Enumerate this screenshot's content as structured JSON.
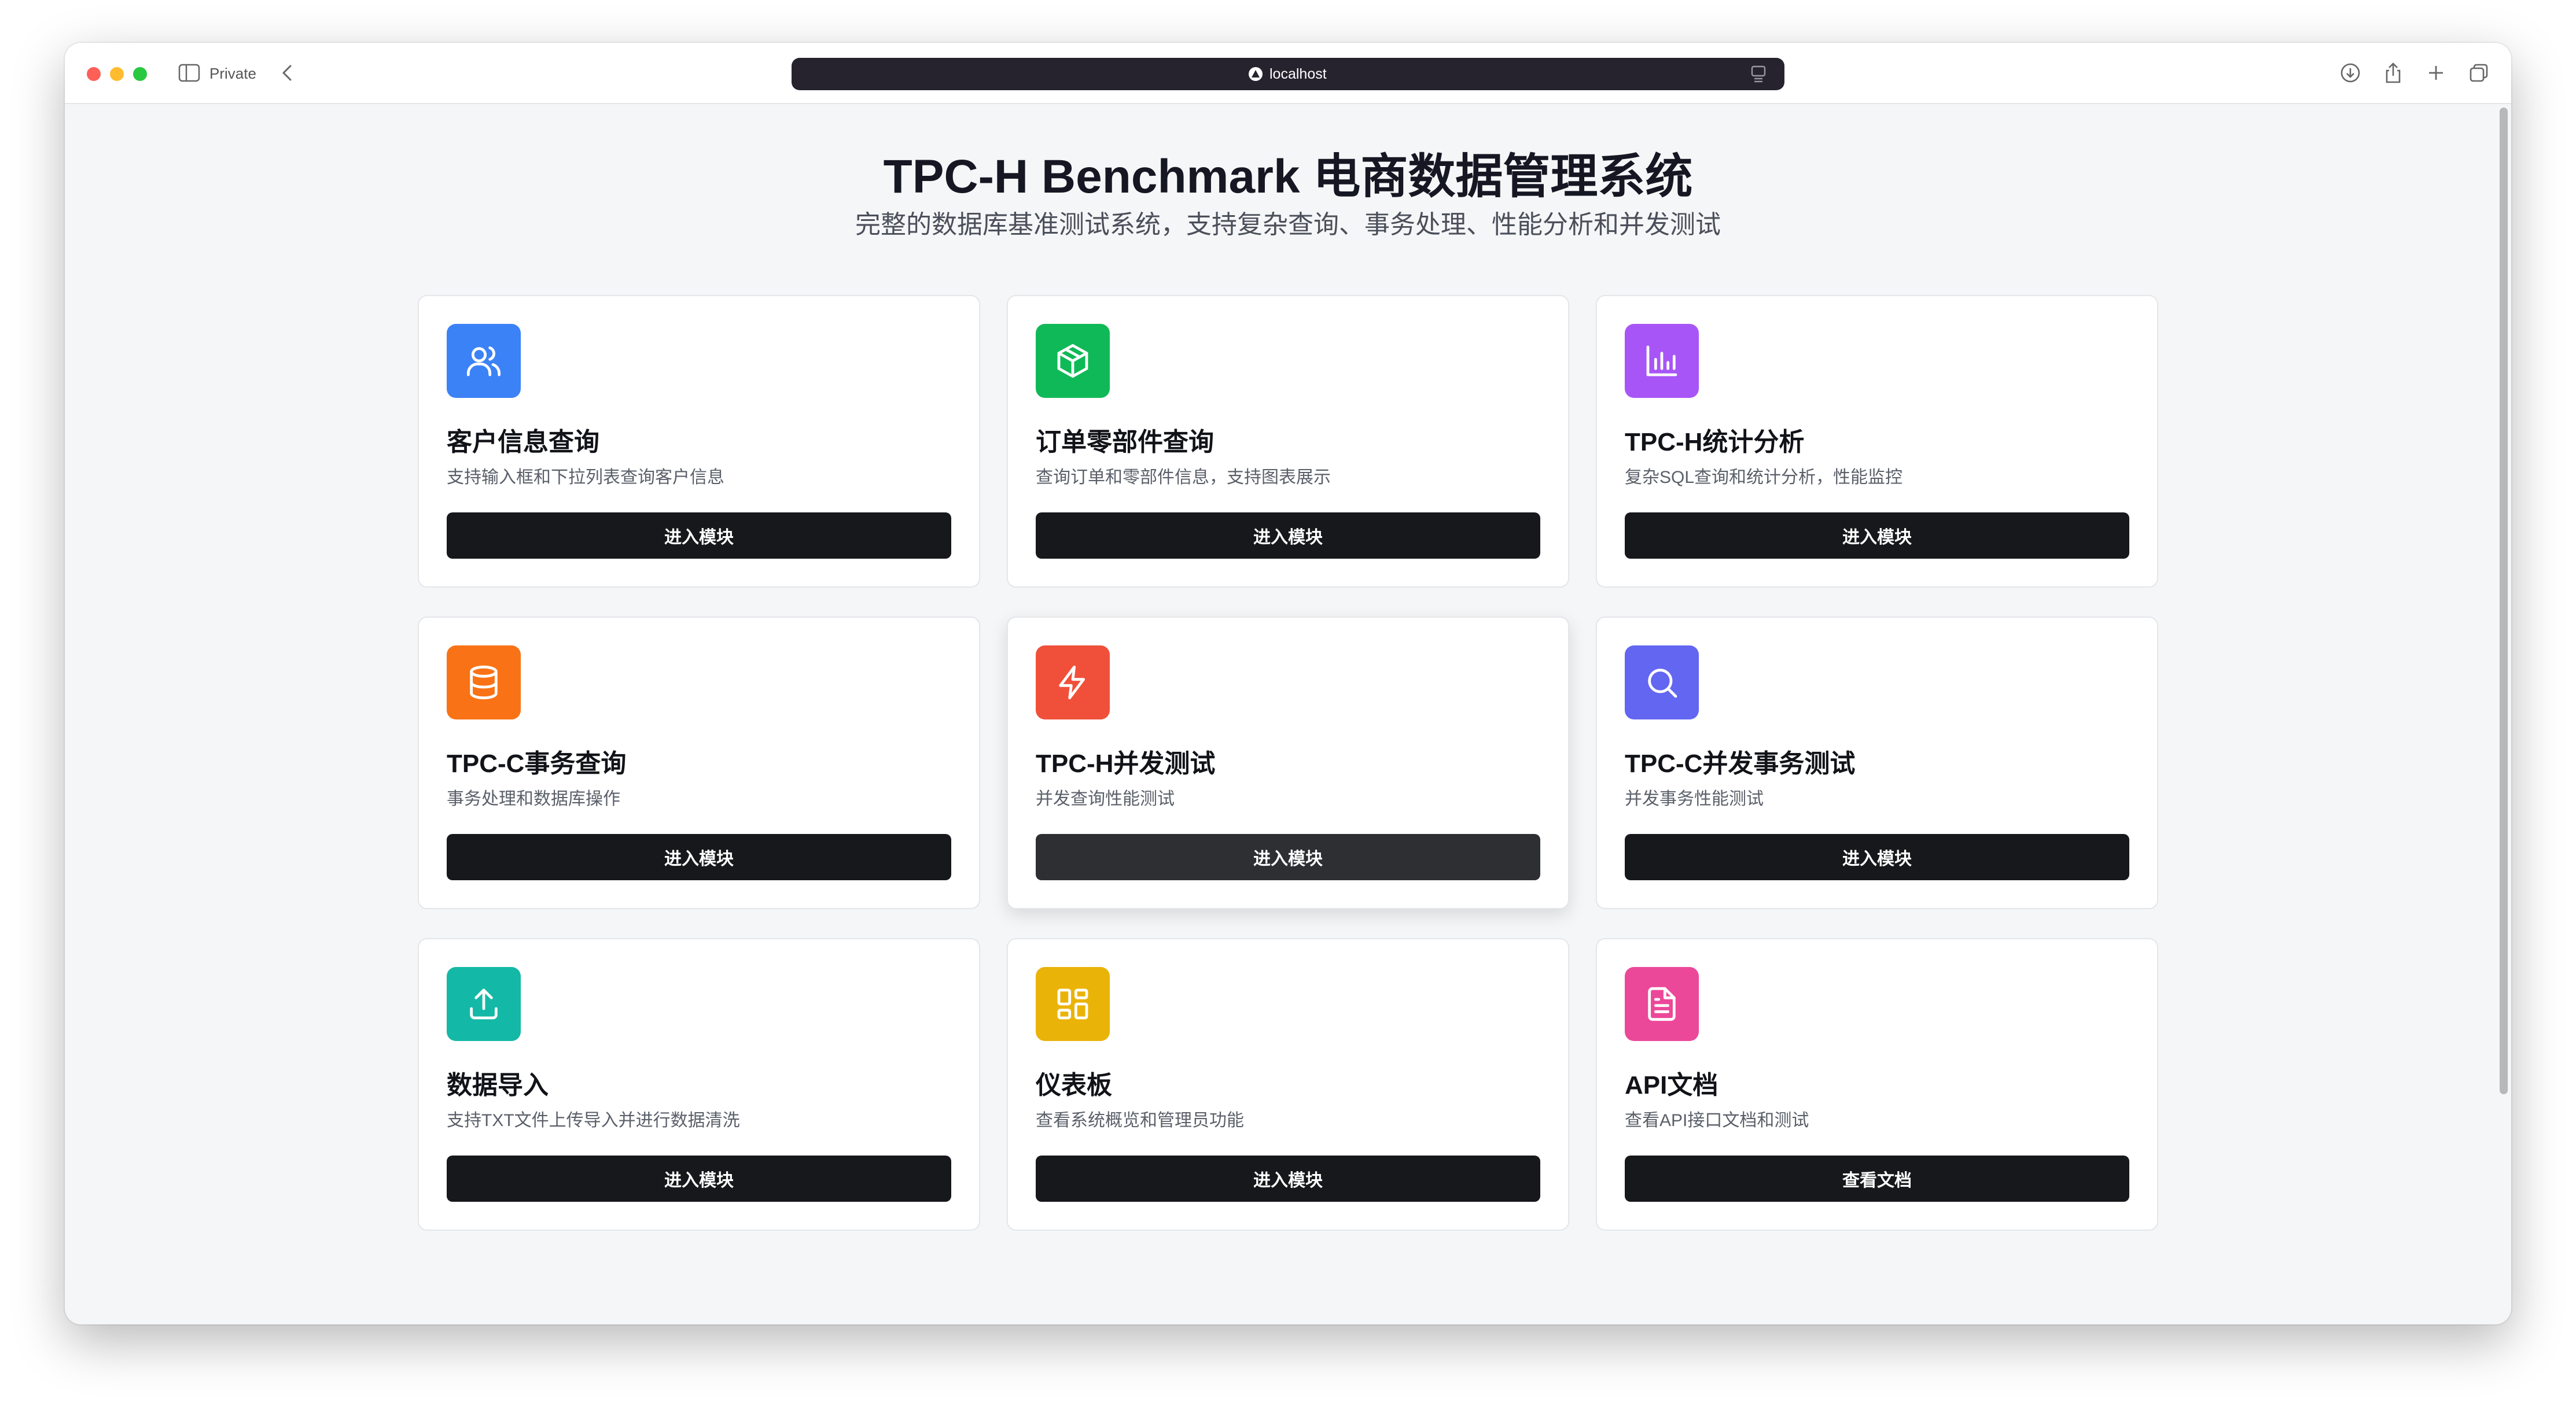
{
  "browser": {
    "private_label": "Private",
    "url": "localhost"
  },
  "page": {
    "title": "TPC-H Benchmark 电商数据管理系统",
    "subtitle": "完整的数据库基准测试系统，支持复杂查询、事务处理、性能分析和并发测试"
  },
  "cards": [
    {
      "title": "客户信息查询",
      "desc": "支持输入框和下拉列表查询客户信息",
      "button": "进入模块",
      "icon": "users-icon",
      "color": "#3b82f6"
    },
    {
      "title": "订单零部件查询",
      "desc": "查询订单和零部件信息，支持图表展示",
      "button": "进入模块",
      "icon": "package-icon",
      "color": "#10b957"
    },
    {
      "title": "TPC-H统计分析",
      "desc": "复杂SQL查询和统计分析，性能监控",
      "button": "进入模块",
      "icon": "bar-chart-icon",
      "color": "#a855f7"
    },
    {
      "title": "TPC-C事务查询",
      "desc": "事务处理和数据库操作",
      "button": "进入模块",
      "icon": "database-icon",
      "color": "#f97316"
    },
    {
      "title": "TPC-H并发测试",
      "desc": "并发查询性能测试",
      "button": "进入模块",
      "icon": "lightning-icon",
      "color": "#f0503a"
    },
    {
      "title": "TPC-C并发事务测试",
      "desc": "并发事务性能测试",
      "button": "进入模块",
      "icon": "search-icon",
      "color": "#6366f1"
    },
    {
      "title": "数据导入",
      "desc": "支持TXT文件上传导入并进行数据清洗",
      "button": "进入模块",
      "icon": "upload-icon",
      "color": "#14b8a6"
    },
    {
      "title": "仪表板",
      "desc": "查看系统概览和管理员功能",
      "button": "进入模块",
      "icon": "dashboard-icon",
      "color": "#eab308"
    },
    {
      "title": "API文档",
      "desc": "查看API接口文档和测试",
      "button": "查看文档",
      "icon": "document-icon",
      "color": "#ec4899"
    }
  ]
}
